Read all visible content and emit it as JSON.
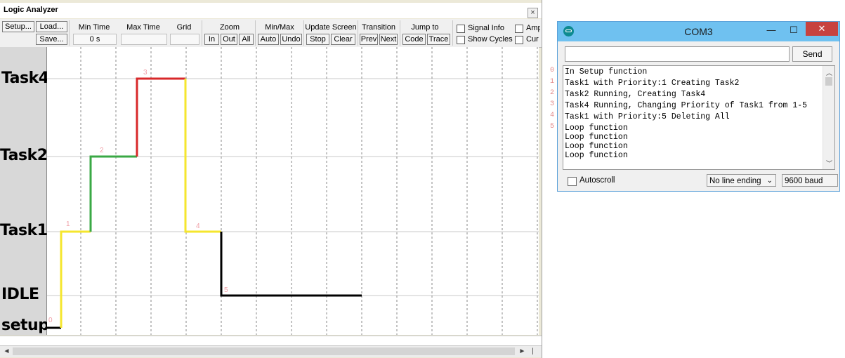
{
  "logic_analyzer": {
    "title": "Logic Analyzer",
    "close_glyph": "×",
    "toolbar": {
      "setup": "Setup...",
      "load": "Load...",
      "save": "Save...",
      "min_time_label": "Min Time",
      "min_time_value": "0 s",
      "max_time_label": "Max Time",
      "grid_label": "Grid",
      "zoom_label": "Zoom",
      "zoom_in": "In",
      "zoom_out": "Out",
      "zoom_all": "All",
      "minmax_label": "Min/Max",
      "auto": "Auto",
      "undo": "Undo",
      "update_label": "Update Screen",
      "stop": "Stop",
      "clear": "Clear",
      "transition_label": "Transition",
      "prev": "Prev",
      "next": "Next",
      "jump_label": "Jump to",
      "code": "Code",
      "trace": "Trace",
      "signal_info": "Signal Info",
      "show_cycles": "Show Cycles",
      "amp": "Amp",
      "cur": "Cur"
    },
    "signals": [
      "Task4",
      "Task2",
      "Task1",
      "IDLE",
      "setup"
    ],
    "scroll_left": "◄",
    "scroll_right": "►",
    "scroll_end": "|"
  },
  "chart_data": {
    "type": "line",
    "series": [
      {
        "color": "#000000",
        "points": [
          [
            0,
            4
          ],
          [
            1,
            4
          ]
        ]
      },
      {
        "color": "#f5e62e",
        "points": [
          [
            1,
            4
          ],
          [
            1,
            2
          ],
          [
            2,
            2
          ]
        ]
      },
      {
        "color": "#3aa845",
        "points": [
          [
            2,
            2
          ],
          [
            2,
            1
          ],
          [
            3,
            1
          ]
        ]
      },
      {
        "color": "#d8282a",
        "points": [
          [
            3,
            1
          ],
          [
            3,
            0
          ],
          [
            4,
            0
          ]
        ]
      },
      {
        "color": "#f5e62e",
        "points": [
          [
            4,
            0
          ],
          [
            4,
            2
          ],
          [
            5,
            2
          ]
        ]
      },
      {
        "color": "#000000",
        "points": [
          [
            5,
            2
          ],
          [
            5,
            3
          ],
          [
            6,
            3
          ]
        ]
      }
    ],
    "markers": [
      "0",
      "1",
      "2",
      "3",
      "4",
      "5"
    ],
    "marker_color": "#f0a0a8"
  },
  "com_window": {
    "title": "COM3",
    "minimize": "—",
    "maximize": "☐",
    "close": "✕",
    "input_value": "",
    "send": "Send",
    "output_lines": [
      "In Setup function",
      "Task1 with Priority:1 Creating Task2",
      "Task2 Running, Creating Task4",
      "Task4 Running, Changing Priority of Task1 from 1-5",
      "Task1 with Priority:5 Deleting All",
      "Loop function",
      "Loop function",
      "Loop function",
      "Loop function"
    ],
    "autoscroll": "Autoscroll",
    "line_ending": "No line ending",
    "baud": "9600 baud",
    "line_index": [
      "0",
      "1",
      "2",
      "3",
      "4",
      "5"
    ]
  }
}
